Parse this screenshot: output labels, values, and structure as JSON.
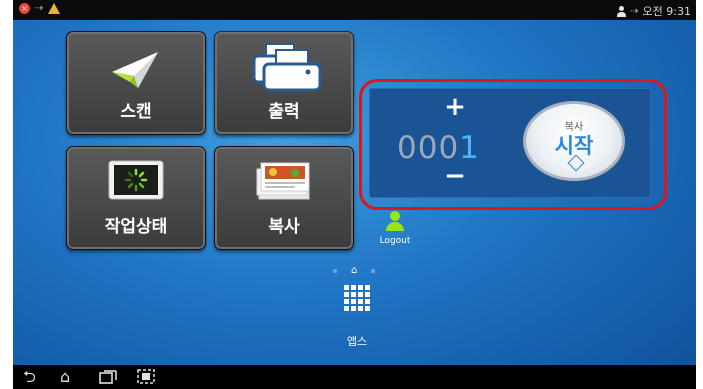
{
  "statusbar": {
    "left_icons": [
      "error-icon",
      "usb-icon",
      "warning-icon"
    ],
    "right_text": "오전 9:31"
  },
  "tiles": {
    "scan": "스캔",
    "print": "출력",
    "job_status": "작업상태",
    "copy": "복사"
  },
  "copy_panel": {
    "plus": "+",
    "minus": "−",
    "count_leading": "000",
    "count_last": "1",
    "start_top": "복사",
    "start_main": "시작"
  },
  "logout": "Logout",
  "apps_label": "앱스",
  "colors": {
    "accent_blue": "#2a88d6",
    "highlight_red": "#e01515",
    "user_green": "#9be41a"
  }
}
